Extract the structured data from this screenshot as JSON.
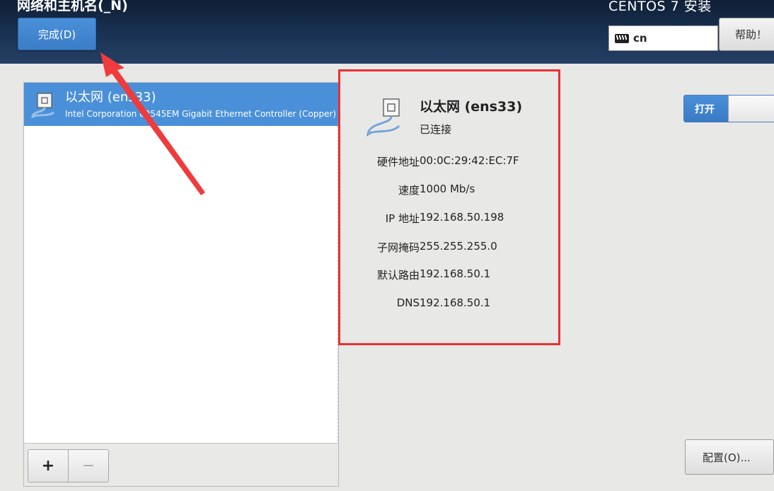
{
  "header": {
    "page_title": "网络和主机名(_N)",
    "done_label": "完成(D)",
    "install_title": "CENTOS 7 安装",
    "keyboard_layout": "cn",
    "help_label": "帮助！"
  },
  "device_list": {
    "items": [
      {
        "name": "以太网 (ens33)",
        "description": "Intel Corporation 82545EM Gigabit Ethernet Controller (Copper)",
        "selected": true
      }
    ],
    "add_label": "+",
    "remove_label": "−"
  },
  "details": {
    "name": "以太网 (ens33)",
    "status": "已连接",
    "rows": [
      {
        "label": "硬件地址",
        "value": "00:0C:29:42:EC:7F"
      },
      {
        "label": "速度",
        "value": "1000 Mb/s"
      },
      {
        "label": "IP 地址",
        "value": "192.168.50.198"
      },
      {
        "label": "子网掩码",
        "value": "255.255.255.0"
      },
      {
        "label": "默认路由",
        "value": "192.168.50.1"
      },
      {
        "label": "DNS",
        "value": "192.168.50.1"
      }
    ]
  },
  "toggle": {
    "on_label": "打开",
    "state": true
  },
  "config_label": "配置(O)...",
  "colors": {
    "header_bg": "#1a3354",
    "accent_blue": "#4a90d9",
    "annotation_red": "#ea3030",
    "page_bg": "#e8e8e7"
  },
  "icons": [
    "keyboard-icon",
    "ethernet-icon",
    "arrow-annotation"
  ]
}
